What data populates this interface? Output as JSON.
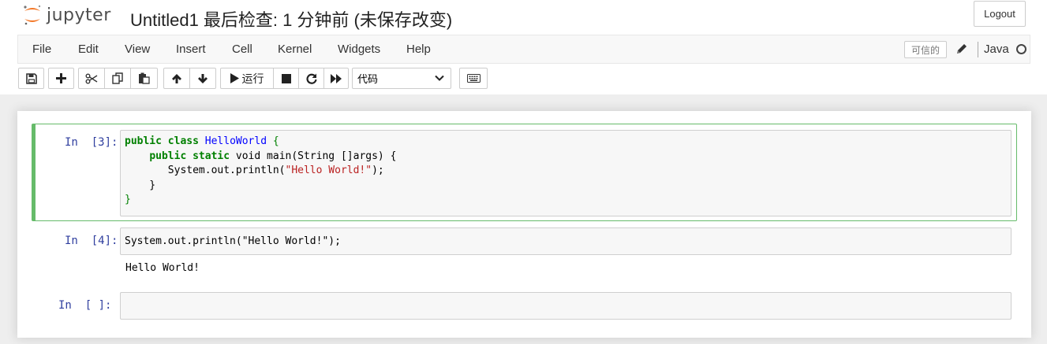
{
  "header": {
    "logo_text": "jupyter",
    "notebook_name": "Untitled1",
    "save_status": "最后检查: 1 分钟前  (未保存改变)",
    "logout_label": "Logout"
  },
  "menubar": {
    "items": [
      "File",
      "Edit",
      "View",
      "Insert",
      "Cell",
      "Kernel",
      "Widgets",
      "Help"
    ],
    "trusted_label": "可信的",
    "kernel_name": "Java"
  },
  "toolbar": {
    "run_label": "运行",
    "cell_type": "代码",
    "buttons": [
      "save-icon",
      "plus-icon",
      "cut-icon",
      "copy-icon",
      "paste-icon",
      "arrow-up-icon",
      "arrow-down-icon",
      "play-icon",
      "stop-icon",
      "restart-icon",
      "fast-forward-icon",
      "keyboard-icon"
    ]
  },
  "cells": [
    {
      "prompt": "In  [3]:",
      "code_lines": [
        "public class HelloWorld {",
        "    public static void main(String []args) {",
        "       System.out.println(\"Hello World!\");",
        "    }",
        "}"
      ],
      "output": ""
    },
    {
      "prompt": "In  [4]:",
      "code_lines": [
        "System.out.println(\"Hello World!\");"
      ],
      "output": "Hello World!"
    },
    {
      "prompt": "In  [ ]:",
      "code_lines": [
        ""
      ],
      "output": ""
    }
  ],
  "colors": {
    "prompt_in": "#303f9f",
    "selected_cell_border": "#66bb6a",
    "keyword": "#008000",
    "class_name": "#0000ff",
    "string": "#ba2121",
    "logo_orange": "#f37726"
  }
}
